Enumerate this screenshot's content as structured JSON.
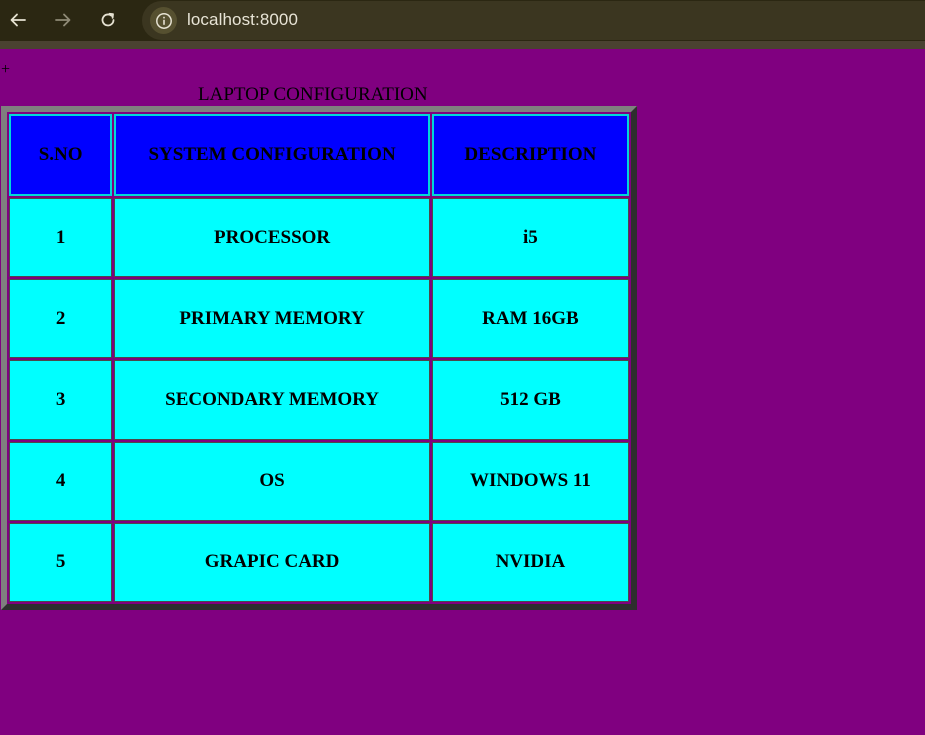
{
  "browser": {
    "url": "localhost:8000",
    "icons": [
      "back-arrow-icon",
      "forward-arrow-icon",
      "reload-icon",
      "site-info-icon"
    ]
  },
  "page": {
    "plus_mark": "+",
    "caption": "LAPTOP CONFIGURATION",
    "background_color": "#800080",
    "header_color": "#0000ff",
    "cell_color": "#00ffff"
  },
  "table": {
    "headers": [
      "S.NO",
      "SYSTEM CONFIGURATION",
      "DESCRIPTION"
    ],
    "rows": [
      [
        "1",
        "PROCESSOR",
        "i5"
      ],
      [
        "2",
        "PRIMARY MEMORY",
        "RAM 16GB"
      ],
      [
        "3",
        "SECONDARY MEMORY",
        "512 GB"
      ],
      [
        "4",
        "OS",
        "WINDOWS 11"
      ],
      [
        "5",
        "GRAPIC CARD",
        "NVIDIA"
      ]
    ]
  }
}
